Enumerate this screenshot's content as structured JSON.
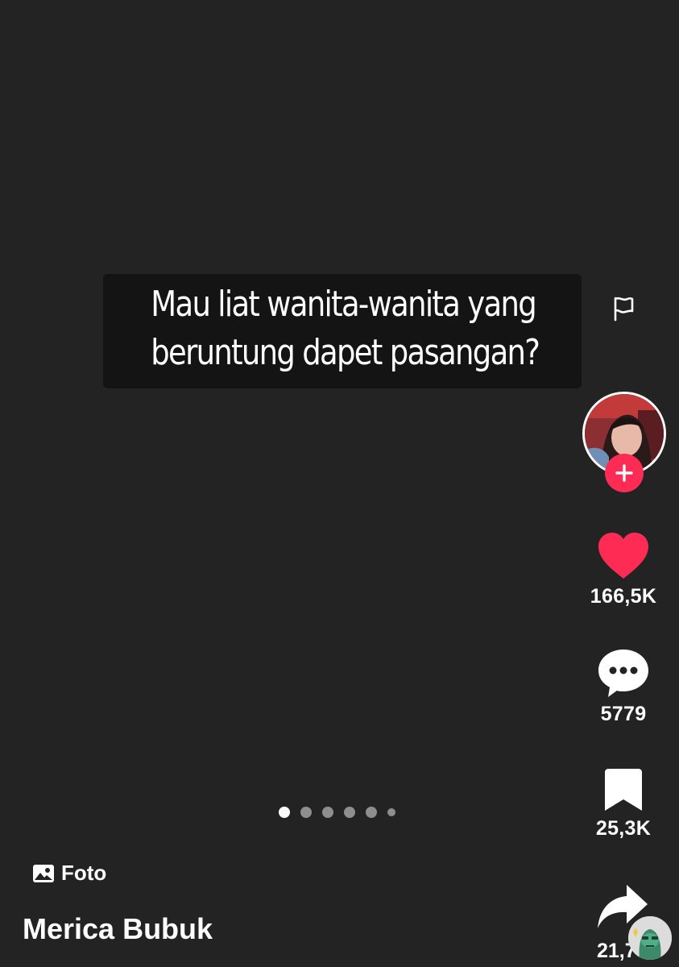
{
  "caption": {
    "line1": "Mau liat wanita-wanita yang",
    "line2": "beruntung dapet pasangan?"
  },
  "actions": {
    "likes": "166,5K",
    "comments": "5779",
    "bookmarks": "25,3K",
    "shares": "21,7"
  },
  "pager": {
    "total_slides": 6,
    "current_slide": 1
  },
  "post": {
    "type_label": "Foto",
    "author": "Merica Bubuk"
  },
  "icons": {
    "report": "flag-icon",
    "follow": "plus-icon",
    "like": "heart-icon",
    "comment": "comment-bubble-icon",
    "bookmark": "bookmark-icon",
    "share": "share-arrow-icon",
    "photo": "image-icon"
  },
  "colors": {
    "background": "#232323",
    "accent": "#fe2c55",
    "like": "#fe2c55",
    "text": "#ffffff"
  }
}
